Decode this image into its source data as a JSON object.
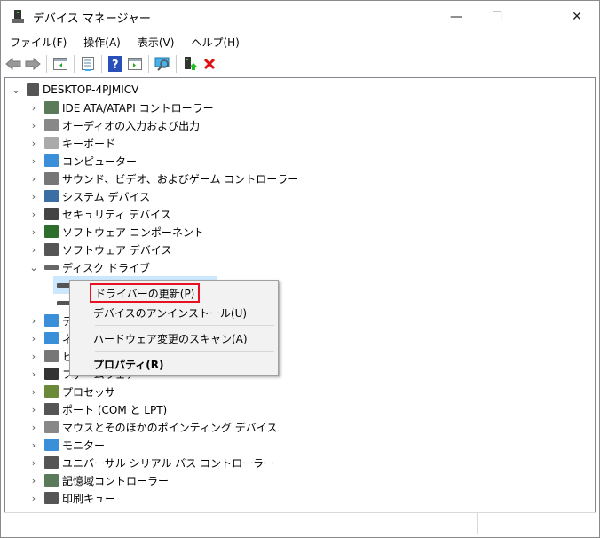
{
  "window": {
    "title": "デバイス マネージャー",
    "minimize": "—",
    "maximize": "☐",
    "close": "✕"
  },
  "menu": [
    "ファイル(F)",
    "操作(A)",
    "表示(V)",
    "ヘルプ(H)"
  ],
  "toolbar": [
    "back-icon",
    "forward-icon",
    "show-hide-console-tree-icon",
    "properties-icon",
    "help-icon",
    "action-pane-icon",
    "scan-hardware-icon",
    "update-driver-icon",
    "uninstall-icon"
  ],
  "tree": {
    "root": "DESKTOP-4PJMICV",
    "items": [
      {
        "label": "IDE ATA/ATAPI コントローラー",
        "color": "#5a7a5a"
      },
      {
        "label": "オーディオの入力および出力",
        "color": "#888"
      },
      {
        "label": "キーボード",
        "color": "#aaa"
      },
      {
        "label": "コンピューター",
        "color": "#3a8fd8"
      },
      {
        "label": "サウンド、ビデオ、およびゲーム コントローラー",
        "color": "#777"
      },
      {
        "label": "システム デバイス",
        "color": "#3a6ea5"
      },
      {
        "label": "セキュリティ デバイス",
        "color": "#444"
      },
      {
        "label": "ソフトウェア コンポーネント",
        "color": "#2d6e2d"
      },
      {
        "label": "ソフトウェア デバイス",
        "color": "#555"
      },
      {
        "label": "ディスク ドライブ",
        "color": "#666",
        "expanded": true
      },
      {
        "label": "",
        "color": "#555",
        "child": true,
        "selected": true
      },
      {
        "label": "",
        "color": "#555",
        "child": true
      },
      {
        "label": "ディスプレイ アダプター",
        "color": "#3a8fd8"
      },
      {
        "label": "ネットワーク アダプター",
        "color": "#3a8fd8"
      },
      {
        "label": "ヒューマン インターフェイス デバイス",
        "color": "#777"
      },
      {
        "label": "ファームウェア",
        "color": "#333"
      },
      {
        "label": "プロセッサ",
        "color": "#6a8a3a"
      },
      {
        "label": "ポート (COM と LPT)",
        "color": "#555"
      },
      {
        "label": "マウスとそのほかのポインティング デバイス",
        "color": "#888"
      },
      {
        "label": "モニター",
        "color": "#3a8fd8"
      },
      {
        "label": "ユニバーサル シリアル バス コントローラー",
        "color": "#555"
      },
      {
        "label": "記憶域コントローラー",
        "color": "#5a7a5a"
      },
      {
        "label": "印刷キュー",
        "color": "#555"
      }
    ]
  },
  "context_menu": {
    "update": "ドライバーの更新(P)",
    "uninstall": "デバイスのアンインストール(U)",
    "scan": "ハードウェア変更のスキャン(A)",
    "properties": "プロパティ(R)",
    "highlight": "#e81123"
  }
}
